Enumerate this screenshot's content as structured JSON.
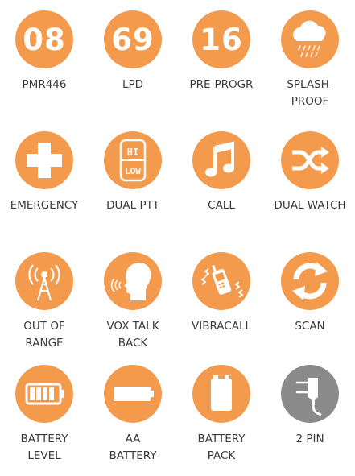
{
  "colors": {
    "accent": "#f39a4d",
    "neutral": "#8a8a8a",
    "text": "#3a3a3a"
  },
  "features": [
    {
      "icon": "number-08-icon",
      "number": "08",
      "label": "PMR446"
    },
    {
      "icon": "number-69-icon",
      "number": "69",
      "label": "LPD"
    },
    {
      "icon": "number-16-icon",
      "number": "16",
      "label": "PRE-PROGR"
    },
    {
      "icon": "rain-cloud-icon",
      "label": "SPLASH-\nPROOF"
    },
    {
      "icon": "cross-icon",
      "label": "EMERGENCY"
    },
    {
      "icon": "hi-low-icon",
      "icon_text_top": "HI",
      "icon_text_bottom": "LOW",
      "label": "DUAL PTT"
    },
    {
      "icon": "music-note-icon",
      "label": "CALL"
    },
    {
      "icon": "shuffle-icon",
      "label": "DUAL WATCH"
    },
    {
      "icon": "antenna-tower-icon",
      "label": "OUT OF\nRANGE"
    },
    {
      "icon": "voice-head-icon",
      "label": "VOX TALK\nBACK"
    },
    {
      "icon": "vibrating-phone-icon",
      "label": "VIBRACALL"
    },
    {
      "icon": "scan-arrows-icon",
      "label": "SCAN"
    },
    {
      "icon": "battery-level-icon",
      "label": "BATTERY\nLEVEL"
    },
    {
      "icon": "aa-battery-icon",
      "label": "AA\nBATTERY"
    },
    {
      "icon": "battery-pack-icon",
      "label": "BATTERY\nPACK"
    },
    {
      "icon": "power-plug-icon",
      "label": "2 PIN"
    }
  ]
}
